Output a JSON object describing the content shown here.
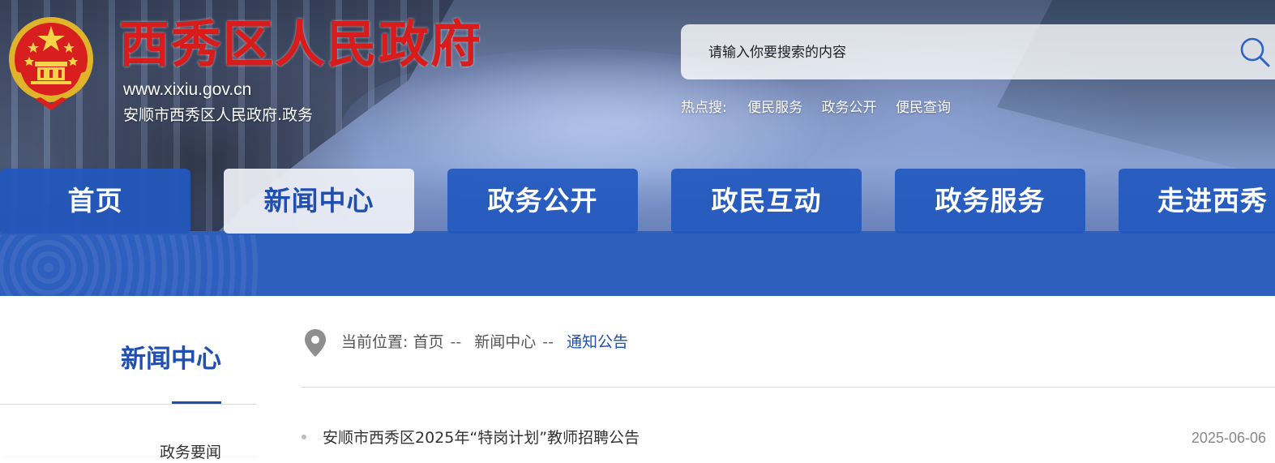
{
  "header": {
    "title": "西秀区人民政府",
    "url": "www.xixiu.gov.cn",
    "subtitle": "安顺市西秀区人民政府.政务",
    "emblem_icon": "national-emblem-icon"
  },
  "search": {
    "placeholder": "请输入你要搜索的内容",
    "value": "",
    "icon": "search-icon",
    "hot_label": "热点搜:",
    "hot_links": [
      "便民服务",
      "政务公开",
      "便民查询"
    ]
  },
  "nav": {
    "items": [
      "首页",
      "新闻中心",
      "政务公开",
      "政民互动",
      "政务服务",
      "走进西秀"
    ],
    "active": "新闻中心"
  },
  "sidebar": {
    "title": "新闻中心",
    "items": [
      "政务要闻"
    ]
  },
  "breadcrumb": {
    "icon": "location-pin-icon",
    "label": "当前位置:",
    "items": [
      "首页",
      "新闻中心",
      "通知公告"
    ],
    "separator": "--"
  },
  "articles": [
    {
      "title": "安顺市西秀区2025年“特岗计划”教师招聘公告",
      "date": "2025-06-06"
    }
  ],
  "colors": {
    "brand_blue": "#2d5fbe",
    "title_red": "#d81b1b",
    "active_text": "#1f4fb0"
  }
}
